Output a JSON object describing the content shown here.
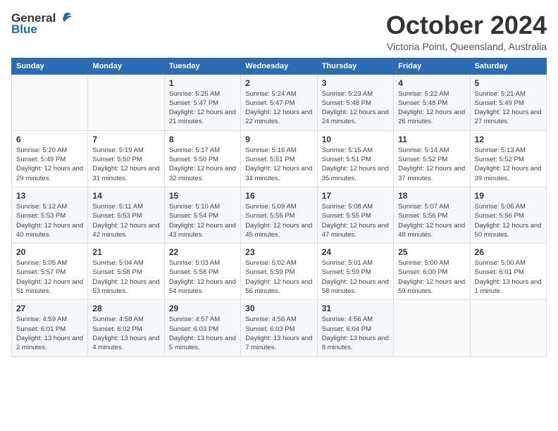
{
  "header": {
    "logo_general": "General",
    "logo_blue": "Blue",
    "title": "October 2024",
    "location": "Victoria Point, Queensland, Australia"
  },
  "days_of_week": [
    "Sunday",
    "Monday",
    "Tuesday",
    "Wednesday",
    "Thursday",
    "Friday",
    "Saturday"
  ],
  "weeks": [
    [
      {
        "day": "",
        "info": ""
      },
      {
        "day": "",
        "info": ""
      },
      {
        "day": "1",
        "info": "Sunrise: 5:25 AM\nSunset: 5:47 PM\nDaylight: 12 hours and 21 minutes."
      },
      {
        "day": "2",
        "info": "Sunrise: 5:24 AM\nSunset: 5:47 PM\nDaylight: 12 hours and 22 minutes."
      },
      {
        "day": "3",
        "info": "Sunrise: 5:23 AM\nSunset: 5:48 PM\nDaylight: 12 hours and 24 minutes."
      },
      {
        "day": "4",
        "info": "Sunrise: 5:22 AM\nSunset: 5:48 PM\nDaylight: 12 hours and 26 minutes."
      },
      {
        "day": "5",
        "info": "Sunrise: 5:21 AM\nSunset: 5:49 PM\nDaylight: 12 hours and 27 minutes."
      }
    ],
    [
      {
        "day": "6",
        "info": "Sunrise: 5:20 AM\nSunset: 5:49 PM\nDaylight: 12 hours and 29 minutes."
      },
      {
        "day": "7",
        "info": "Sunrise: 5:19 AM\nSunset: 5:50 PM\nDaylight: 12 hours and 31 minutes."
      },
      {
        "day": "8",
        "info": "Sunrise: 5:17 AM\nSunset: 5:50 PM\nDaylight: 12 hours and 32 minutes."
      },
      {
        "day": "9",
        "info": "Sunrise: 5:16 AM\nSunset: 5:51 PM\nDaylight: 12 hours and 34 minutes."
      },
      {
        "day": "10",
        "info": "Sunrise: 5:15 AM\nSunset: 5:51 PM\nDaylight: 12 hours and 35 minutes."
      },
      {
        "day": "11",
        "info": "Sunrise: 5:14 AM\nSunset: 5:52 PM\nDaylight: 12 hours and 37 minutes."
      },
      {
        "day": "12",
        "info": "Sunrise: 5:13 AM\nSunset: 5:52 PM\nDaylight: 12 hours and 39 minutes."
      }
    ],
    [
      {
        "day": "13",
        "info": "Sunrise: 5:12 AM\nSunset: 5:53 PM\nDaylight: 12 hours and 40 minutes."
      },
      {
        "day": "14",
        "info": "Sunrise: 5:11 AM\nSunset: 5:53 PM\nDaylight: 12 hours and 42 minutes."
      },
      {
        "day": "15",
        "info": "Sunrise: 5:10 AM\nSunset: 5:54 PM\nDaylight: 12 hours and 43 minutes."
      },
      {
        "day": "16",
        "info": "Sunrise: 5:09 AM\nSunset: 5:55 PM\nDaylight: 12 hours and 45 minutes."
      },
      {
        "day": "17",
        "info": "Sunrise: 5:08 AM\nSunset: 5:55 PM\nDaylight: 12 hours and 47 minutes."
      },
      {
        "day": "18",
        "info": "Sunrise: 5:07 AM\nSunset: 5:56 PM\nDaylight: 12 hours and 48 minutes."
      },
      {
        "day": "19",
        "info": "Sunrise: 5:06 AM\nSunset: 5:56 PM\nDaylight: 12 hours and 50 minutes."
      }
    ],
    [
      {
        "day": "20",
        "info": "Sunrise: 5:05 AM\nSunset: 5:57 PM\nDaylight: 12 hours and 51 minutes."
      },
      {
        "day": "21",
        "info": "Sunrise: 5:04 AM\nSunset: 5:58 PM\nDaylight: 12 hours and 53 minutes."
      },
      {
        "day": "22",
        "info": "Sunrise: 5:03 AM\nSunset: 5:58 PM\nDaylight: 12 hours and 54 minutes."
      },
      {
        "day": "23",
        "info": "Sunrise: 5:02 AM\nSunset: 5:59 PM\nDaylight: 12 hours and 56 minutes."
      },
      {
        "day": "24",
        "info": "Sunrise: 5:01 AM\nSunset: 5:59 PM\nDaylight: 12 hours and 58 minutes."
      },
      {
        "day": "25",
        "info": "Sunrise: 5:00 AM\nSunset: 6:00 PM\nDaylight: 12 hours and 59 minutes."
      },
      {
        "day": "26",
        "info": "Sunrise: 5:00 AM\nSunset: 6:01 PM\nDaylight: 13 hours and 1 minute."
      }
    ],
    [
      {
        "day": "27",
        "info": "Sunrise: 4:59 AM\nSunset: 6:01 PM\nDaylight: 13 hours and 2 minutes."
      },
      {
        "day": "28",
        "info": "Sunrise: 4:58 AM\nSunset: 6:02 PM\nDaylight: 13 hours and 4 minutes."
      },
      {
        "day": "29",
        "info": "Sunrise: 4:57 AM\nSunset: 6:03 PM\nDaylight: 13 hours and 5 minutes."
      },
      {
        "day": "30",
        "info": "Sunrise: 4:56 AM\nSunset: 6:03 PM\nDaylight: 13 hours and 7 minutes."
      },
      {
        "day": "31",
        "info": "Sunrise: 4:56 AM\nSunset: 6:04 PM\nDaylight: 13 hours and 8 minutes."
      },
      {
        "day": "",
        "info": ""
      },
      {
        "day": "",
        "info": ""
      }
    ]
  ]
}
